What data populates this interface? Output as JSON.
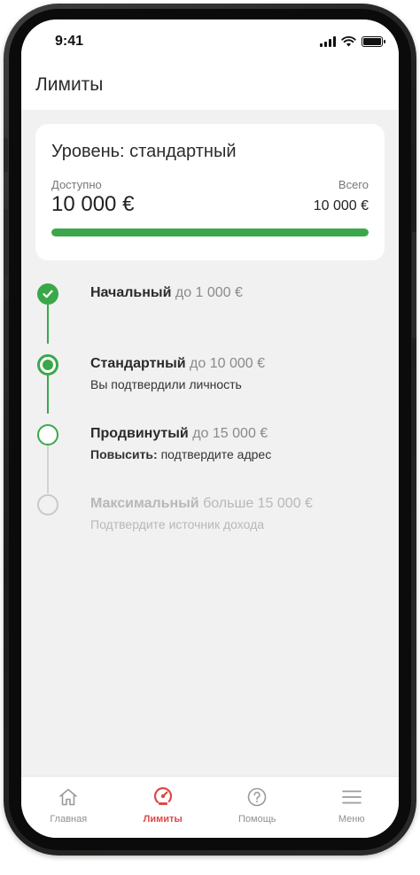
{
  "status_bar": {
    "time": "9:41"
  },
  "header": {
    "title": "Лимиты"
  },
  "level_card": {
    "title": "Уровень: стандартный",
    "available_label": "Доступно",
    "available_amount": "10 000 €",
    "total_label": "Всего",
    "total_amount": "10 000 €",
    "progress_fraction": 1.0
  },
  "levels": [
    {
      "name": "Начальный",
      "limit": "до 1 000 €",
      "sub_strong": "",
      "sub_text": "",
      "state": "done"
    },
    {
      "name": "Стандартный",
      "limit": "до 10 000 €",
      "sub_strong": "",
      "sub_text": "Вы подтвердили личность",
      "state": "current"
    },
    {
      "name": "Продвинутый",
      "limit": "до 15 000 €",
      "sub_strong": "Повысить:",
      "sub_text": "подтвердите адрес",
      "state": "next"
    },
    {
      "name": "Максимальный",
      "limit": "больше 15 000 €",
      "sub_strong": "",
      "sub_text": "Подтвердите источник дохода",
      "state": "locked"
    }
  ],
  "tabs": [
    {
      "label": "Главная",
      "icon": "home-icon",
      "active": false
    },
    {
      "label": "Лимиты",
      "icon": "speedometer-icon",
      "active": true
    },
    {
      "label": "Помощь",
      "icon": "help-icon",
      "active": false
    },
    {
      "label": "Меню",
      "icon": "menu-icon",
      "active": false
    }
  ],
  "colors": {
    "accent_green": "#3aa84a",
    "active_tab_red": "#e04848",
    "inactive_grey": "#c9c9c9"
  }
}
